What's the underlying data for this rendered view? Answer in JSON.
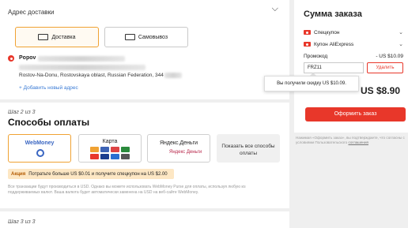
{
  "address": {
    "title": "Адрес доставки",
    "delivery_label": "Доставка",
    "pickup_label": "Самовывоз",
    "name": "Popov",
    "address_line": "Rostov-Na-Donu, Rostovskaya oblast, Russian Federation, 344",
    "add_link": "+ Добавить новый адрес"
  },
  "payment": {
    "step": "Шаг 2 из 3",
    "title": "Способы оплаты",
    "methods": [
      "WebMoney",
      "Карта",
      "Яндекс.Деньги"
    ],
    "yandex_logo": "Яндекс Деньги",
    "show_all": "Показать все способы оплаты",
    "promo_tag": "Акция",
    "promo_text": "Потратьте больше US $0.01 и получите спецкупон на US $2.00",
    "fine_print": "Все транзакции будут производиться в USD. Однако вы можете использовать WebMoney Purse для оплаты, используя любую из поддерживаемых валют. Ваша валюта будет автоматически заменена на USD на веб-сайте WebMoney."
  },
  "step3": {
    "step": "Шаг 3 из 3"
  },
  "summary": {
    "title": "Сумма заказа",
    "coupons": [
      "Спецкупон",
      "Купон AliExpress"
    ],
    "promo_label": "Промокод",
    "promo_amount": "- US $10.09",
    "promo_value": "FRZ11",
    "delete_label": "Удалить",
    "tooltip": "Вы получили скидку US $10.09.",
    "total": "US $8.90",
    "order_button": "Оформить заказ",
    "legal_pre": "Нажимая «Оформить заказ», вы подтверждаете, что согласны с условиями Пользовательского",
    "legal_link": "соглашения",
    "accent_color": "#e8372a",
    "selected_color": "#f0a233"
  }
}
